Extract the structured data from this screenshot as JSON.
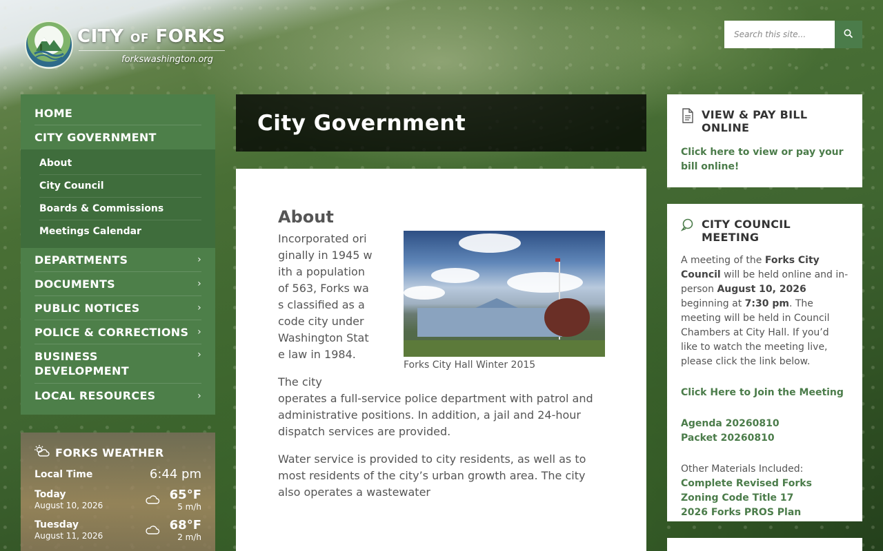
{
  "header": {
    "logo_title_city": "CITY",
    "logo_title_of": "OF",
    "logo_title_forks": "FORKS",
    "logo_url": "forkswashington.org",
    "search_placeholder": "Search this site..."
  },
  "nav": {
    "home": "HOME",
    "current": "CITY GOVERNMENT",
    "sub_items": [
      "About",
      "City Council",
      "Boards & Commissions",
      "Meetings Calendar"
    ],
    "items": [
      "DEPARTMENTS",
      "DOCUMENTS",
      "PUBLIC NOTICES",
      "POLICE & CORRECTIONS",
      "BUSINESS DEVELOPMENT",
      "LOCAL RESOURCES"
    ],
    "chevron": "›"
  },
  "weather": {
    "title": "FORKS WEATHER",
    "local_time_label": "Local Time",
    "local_time": "6:44 pm",
    "days": [
      {
        "name": "Today",
        "date": "August 10, 2026",
        "temp": "65°F",
        "wind": "5 m/h"
      },
      {
        "name": "Tuesday",
        "date": "August 11, 2026",
        "temp": "68°F",
        "wind": "2 m/h"
      }
    ]
  },
  "page": {
    "title": "City Government",
    "heading": "About",
    "caption": "Forks City Hall Winter 2015",
    "paragraphs": [
      "Incorporated originally in 1945 with a population of 563, Forks was classified as a code city under Washington State law in 1984.",
      "The city operates a full-service police department with patrol and administrative positions. In addition, a jail and 24-hour dispatch services are provided.",
      "Water service is provided to city residents, as well as to most residents of the city’s urban growth area. The city also operates a wastewater"
    ]
  },
  "sidebar": {
    "bill": {
      "title": "VIEW & PAY BILL ONLINE",
      "link": "Click here to view or pay your bill online!"
    },
    "meeting": {
      "title": "CITY COUNCIL MEETING",
      "text_1": "A meeting of the ",
      "bold_1": "Forks City Council",
      "text_2": " will be held online and in-person ",
      "bold_2": "August 10, 2026",
      "text_3": " beginning at ",
      "bold_3": "7:30 pm",
      "text_4": ". The meeting will be held in Council Chambers at City Hall. If you’d like to watch the meeting live, please click the link below.",
      "join_link": "Click Here to Join the Meeting",
      "agenda_link": "Agenda 20260810",
      "packet_link": "Packet 20260810",
      "other_label": "Other Materials Included:",
      "materials": [
        "Complete Revised Forks Zoning Code Title 17",
        "2026 Forks PROS Plan"
      ]
    }
  },
  "colors": {
    "nav_green": "#4d7f49",
    "link_green": "#4b7c4a",
    "title_bar": "#000000"
  }
}
